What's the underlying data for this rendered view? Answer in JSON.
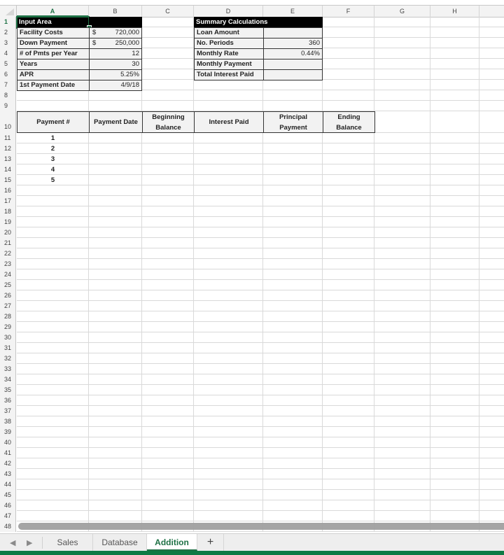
{
  "spreadsheet": {
    "columns": [
      "A",
      "B",
      "C",
      "D",
      "E",
      "F",
      "G",
      "H"
    ],
    "active_column": "A",
    "active_row": 1,
    "row_numbers": [
      1,
      2,
      3,
      4,
      5,
      6,
      7,
      8,
      9,
      10,
      11,
      12,
      13,
      14,
      15,
      16,
      17,
      18,
      19,
      20,
      21,
      22,
      23,
      24,
      25,
      26,
      27,
      28,
      29,
      30,
      31,
      32,
      33,
      34,
      35,
      36,
      37,
      38,
      39,
      40,
      41,
      42,
      43,
      44,
      45,
      46,
      47,
      48
    ]
  },
  "input_area": {
    "title": "Input Area",
    "rows": [
      {
        "label": "Facility Costs",
        "currency": "$",
        "value": "720,000"
      },
      {
        "label": "Down Payment",
        "currency": "$",
        "value": "250,000"
      },
      {
        "label": "# of Pmts per Year",
        "currency": "",
        "value": "12"
      },
      {
        "label": "Years",
        "currency": "",
        "value": "30"
      },
      {
        "label": "APR",
        "currency": "",
        "value": "5.25%"
      },
      {
        "label": "1st Payment Date",
        "currency": "",
        "value": "4/9/18"
      }
    ]
  },
  "summary": {
    "title": "Summary Calculations",
    "rows": [
      {
        "label": "Loan Amount",
        "value": ""
      },
      {
        "label": "No. Periods",
        "value": "360"
      },
      {
        "label": "Monthly Rate",
        "value": "0.44%"
      },
      {
        "label": "Monthly Payment",
        "value": ""
      },
      {
        "label": "Total Interest Paid",
        "value": ""
      }
    ]
  },
  "schedule": {
    "headers": [
      "Payment #",
      "Payment Date",
      "Beginning Balance",
      "Interest Paid",
      "Principal Payment",
      "Ending Balance"
    ],
    "payment_numbers": [
      "1",
      "2",
      "3",
      "4",
      "5"
    ]
  },
  "sheet_tabs": {
    "prev_icon": "triangle-left",
    "next_icon": "triangle-right",
    "tabs": [
      {
        "label": "Sales",
        "active": false
      },
      {
        "label": "Database",
        "active": false
      },
      {
        "label": "Addition",
        "active": true
      }
    ],
    "add_label": "+"
  },
  "colors": {
    "accent": "#1e7145",
    "status_bar": "#0e7a45"
  }
}
